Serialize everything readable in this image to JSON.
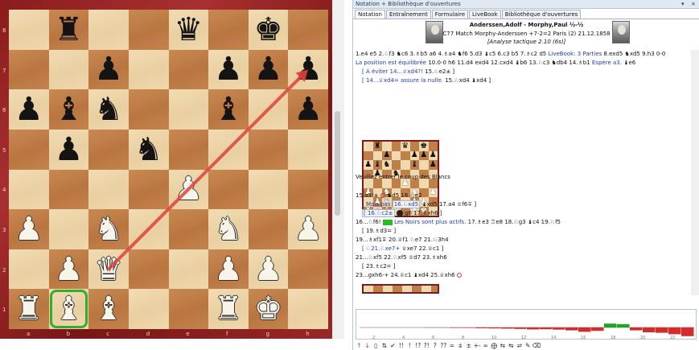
{
  "board": {
    "files": [
      "a",
      "b",
      "c",
      "d",
      "e",
      "f",
      "g",
      "h"
    ],
    "ranks": [
      "8",
      "7",
      "6",
      "5",
      "4",
      "3",
      "2",
      "1"
    ],
    "rows": [
      [
        ".",
        "r",
        ".",
        ".",
        "q",
        ".",
        "k",
        "."
      ],
      [
        ".",
        ".",
        "p",
        ".",
        ".",
        "p",
        "p",
        "p"
      ],
      [
        "p",
        "b",
        "n",
        ".",
        ".",
        "b",
        ".",
        "p"
      ],
      [
        ".",
        "p",
        ".",
        "n",
        ".",
        ".",
        ".",
        "."
      ],
      [
        ".",
        ".",
        ".",
        ".",
        "P",
        ".",
        ".",
        "."
      ],
      [
        "P",
        ".",
        "N",
        ".",
        ".",
        "N",
        ".",
        "P"
      ],
      [
        ".",
        "P",
        "Q",
        ".",
        ".",
        "P",
        "P",
        "."
      ],
      [
        "R",
        "B",
        "B",
        ".",
        ".",
        "R",
        "K",
        "."
      ]
    ],
    "highlight_square": "b1",
    "arrow": {
      "from": "c2",
      "to": "h7",
      "color": "#e2403a"
    }
  },
  "panel": {
    "window_title": "Notation + Bibliothèque d'ouvertures",
    "close_glyph": "×",
    "pin_glyph": "▾",
    "tabs": [
      {
        "label": "Notation",
        "active": true
      },
      {
        "label": "Entraînement",
        "active": false
      },
      {
        "label": "Formulaire",
        "active": false
      },
      {
        "label": "LiveBook",
        "active": false
      },
      {
        "label": "Bibliothèque d'ouvertures",
        "active": false
      }
    ],
    "header": {
      "players": "Anderssen,Adolf - Morphy,Paul ½-½",
      "event": "C77 Match Morphy-Anderssen +7-2=2 Paris (2)  21.12.1858",
      "analysis": "[Analyse tactique 2.10 (6s)]"
    },
    "notation": {
      "l1a": "1.e4  e5  2.♘f3  ♞c6  3.♗b5  a6  4.♗a4  ♞f6  5.d3  ♝c5  6.c3  b5  7.♗c2  d5",
      "l1b": "LiveBook: 3 Parties",
      "l1c": "8.exd5  ♞xd5  9.h3  0-0",
      "l2a": "La position est équilibrée",
      "l2b": "10.0-0  h6  11.d4  exd4  12.cxd4  ♝b6  13.♘c3  ♞db4  14.♗b1",
      "l2c": "Espère a3.",
      "l2d": "♝e6",
      "l3a": "[ A éviter  14...♕xd4?!",
      "l3b": "15.♘e2±  ]",
      "l4a": "[ 14...♕xd4= assure la nulle.",
      "l4b": "15.♘xd4  ♝xd4 ]",
      "prompt": "Veuillez entrer le coup des Blancs",
      "l5": "15.a3!±",
      "l5b": "♞d5  16.♘e2",
      "l6a": "[ Mais pas",
      "l6b": "16.♘xd5",
      "l6c": "♝xd5  17.a4  ♕f6∓ ]",
      "l7a": "[ 16.♘c2±",
      "l7b": "g6  17.♗xh6 ]",
      "l8a": "16...♘f6!",
      "l8b": "Les Noirs sont plus actifs.",
      "l8c": "17.♗e3  ♖e8  18.♘g3  ♝c4  19.♘f5",
      "l9": "[ 19.♗d3= ]",
      "l10": "19...♗xf1∓  20.♕f1  ♘e7  21.♘3h4",
      "l11a": "[ ♘21.♘xe7+",
      "l11b": "♕xe7  22.♕c1 ]",
      "l12": "21...♘xf5  22.♘xf5  ♕d7  23.♗xh6",
      "l13": "[ 23.♗c2= ]",
      "l14": "23...gxh6-+  24.♕c1  ♝xd4  25.♕xh6"
    },
    "eval_graph": {
      "ticks": [
        "2",
        "4",
        "6",
        "8",
        "10",
        "12",
        "14",
        "16",
        "18",
        "20",
        "22"
      ],
      "bars": [
        0,
        0,
        0,
        0,
        0,
        0.02,
        0.02,
        0.05,
        0.05,
        0.08,
        0.1,
        0.12,
        0.15,
        0.2,
        0.18,
        0.22,
        0.3,
        0.45,
        0.35,
        -0.4,
        -0.35,
        0.3,
        0.5,
        0.55,
        0.7,
        0.9
      ]
    },
    "toolbar": [
      "↑",
      "↓",
      "▯",
      "⇅",
      "✔",
      "!!",
      "!",
      "!?",
      "?!",
      "?",
      "??",
      "=",
      "⩲",
      "±",
      "+-",
      "∞",
      "⨁",
      "⇆",
      "⇆",
      "⇌",
      "✎",
      "⌫"
    ]
  }
}
